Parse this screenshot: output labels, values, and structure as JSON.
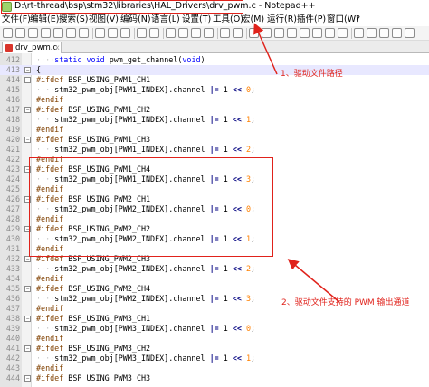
{
  "window": {
    "title": "D:\\rt-thread\\bsp\\stm32\\libraries\\HAL_Drivers\\drv_pwm.c - Notepad++"
  },
  "menu": [
    "文件(F)",
    "编辑(E)",
    "搜索(S)",
    "视图(V)",
    "编码(N)",
    "语言(L)",
    "设置(T)",
    "工具(O)",
    "宏(M)",
    "运行(R)",
    "插件(P)",
    "窗口(W)",
    "?"
  ],
  "tab": {
    "label": "drv_pwm.c",
    "close": "x"
  },
  "editor": {
    "lines": [
      {
        "n": "412",
        "text": "    static void pwm_get_channel(void)"
      },
      {
        "n": "413",
        "text": "{"
      },
      {
        "n": "414",
        "text": "#ifdef BSP_USING_PWM1_CH1"
      },
      {
        "n": "415",
        "text": "    stm32_pwm_obj[PWM1_INDEX].channel |= 1 << 0;"
      },
      {
        "n": "416",
        "text": "#endif"
      },
      {
        "n": "417",
        "text": "#ifdef BSP_USING_PWM1_CH2"
      },
      {
        "n": "418",
        "text": "    stm32_pwm_obj[PWM1_INDEX].channel |= 1 << 1;"
      },
      {
        "n": "419",
        "text": "#endif"
      },
      {
        "n": "420",
        "text": "#ifdef BSP_USING_PWM1_CH3"
      },
      {
        "n": "421",
        "text": "    stm32_pwm_obj[PWM1_INDEX].channel |= 1 << 2;"
      },
      {
        "n": "422",
        "text": "#endif"
      },
      {
        "n": "423",
        "text": "#ifdef BSP_USING_PWM1_CH4"
      },
      {
        "n": "424",
        "text": "    stm32_pwm_obj[PWM1_INDEX].channel |= 1 << 3;"
      },
      {
        "n": "425",
        "text": "#endif"
      },
      {
        "n": "426",
        "text": "#ifdef BSP_USING_PWM2_CH1"
      },
      {
        "n": "427",
        "text": "    stm32_pwm_obj[PWM2_INDEX].channel |= 1 << 0;"
      },
      {
        "n": "428",
        "text": "#endif"
      },
      {
        "n": "429",
        "text": "#ifdef BSP_USING_PWM2_CH2"
      },
      {
        "n": "430",
        "text": "    stm32_pwm_obj[PWM2_INDEX].channel |= 1 << 1;"
      },
      {
        "n": "431",
        "text": "#endif"
      },
      {
        "n": "432",
        "text": "#ifdef BSP_USING_PWM2_CH3"
      },
      {
        "n": "433",
        "text": "    stm32_pwm_obj[PWM2_INDEX].channel |= 1 << 2;"
      },
      {
        "n": "434",
        "text": "#endif"
      },
      {
        "n": "435",
        "text": "#ifdef BSP_USING_PWM2_CH4"
      },
      {
        "n": "436",
        "text": "    stm32_pwm_obj[PWM2_INDEX].channel |= 1 << 3;"
      },
      {
        "n": "437",
        "text": "#endif"
      },
      {
        "n": "438",
        "text": "#ifdef BSP_USING_PWM3_CH1"
      },
      {
        "n": "439",
        "text": "    stm32_pwm_obj[PWM3_INDEX].channel |= 1 << 0;"
      },
      {
        "n": "440",
        "text": "#endif"
      },
      {
        "n": "441",
        "text": "#ifdef BSP_USING_PWM3_CH2"
      },
      {
        "n": "442",
        "text": "    stm32_pwm_obj[PWM3_INDEX].channel |= 1 << 1;"
      },
      {
        "n": "443",
        "text": "#endif"
      },
      {
        "n": "444",
        "text": "#ifdef BSP_USING_PWM3_CH3"
      }
    ]
  },
  "annotations": {
    "one": "1、驱动文件路径",
    "two": "2、驱动文件支持的 PWM 输出通道"
  },
  "colors": {
    "annotation": "#e0221b",
    "keyword": "#0000ff",
    "preprocessor": "#804000",
    "number": "#ff8000"
  }
}
